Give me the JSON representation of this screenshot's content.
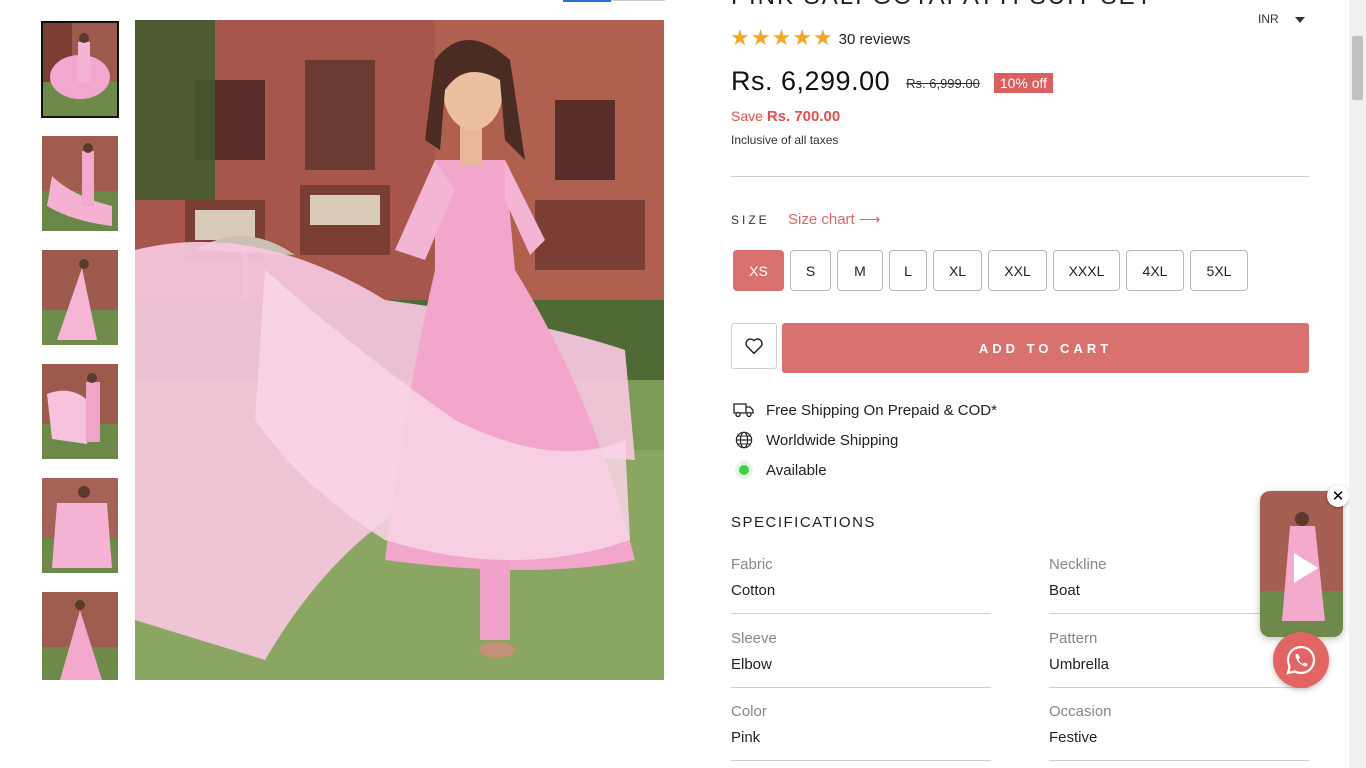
{
  "product": {
    "title_partial": "PINK SALI GOTAPATTI SUIT SET",
    "rating": 5,
    "reviews_text": "30 reviews",
    "price": "Rs. 6,299.00",
    "compare_price": "Rs. 6,999.00",
    "discount_badge": "10% off",
    "save_label": "Save",
    "save_amount": "Rs. 700.00",
    "taxes_note": "Inclusive of all taxes"
  },
  "currency": {
    "selected": "INR"
  },
  "size": {
    "label": "SIZE",
    "chart_link": "Size chart ⟶",
    "options": [
      "XS",
      "S",
      "M",
      "L",
      "XL",
      "XXL",
      "XXXL",
      "4XL",
      "5XL"
    ],
    "selected": "XS"
  },
  "cart": {
    "add_label": "ADD TO CART"
  },
  "features": [
    {
      "icon": "truck-icon",
      "text": "Free Shipping On Prepaid & COD*"
    },
    {
      "icon": "globe-icon",
      "text": "Worldwide Shipping"
    },
    {
      "icon": "available-dot-icon",
      "text": "Available"
    }
  ],
  "specifications": {
    "title": "SPECIFICATIONS",
    "items": [
      {
        "key": "Fabric",
        "value": "Cotton"
      },
      {
        "key": "Neckline",
        "value": "Boat"
      },
      {
        "key": "Sleeve",
        "value": "Elbow"
      },
      {
        "key": "Pattern",
        "value": "Umbrella"
      },
      {
        "key": "Color",
        "value": "Pink"
      },
      {
        "key": "Occasion",
        "value": "Festive"
      }
    ]
  },
  "gallery": {
    "thumbnail_count": 6,
    "active_index": 0
  },
  "colors": {
    "accent": "#d9716f",
    "discount": "#d9605f",
    "save_text": "#e0504e",
    "star": "#f5a623",
    "available": "#3ecf4a",
    "whatsapp_bg": "#e36563"
  }
}
